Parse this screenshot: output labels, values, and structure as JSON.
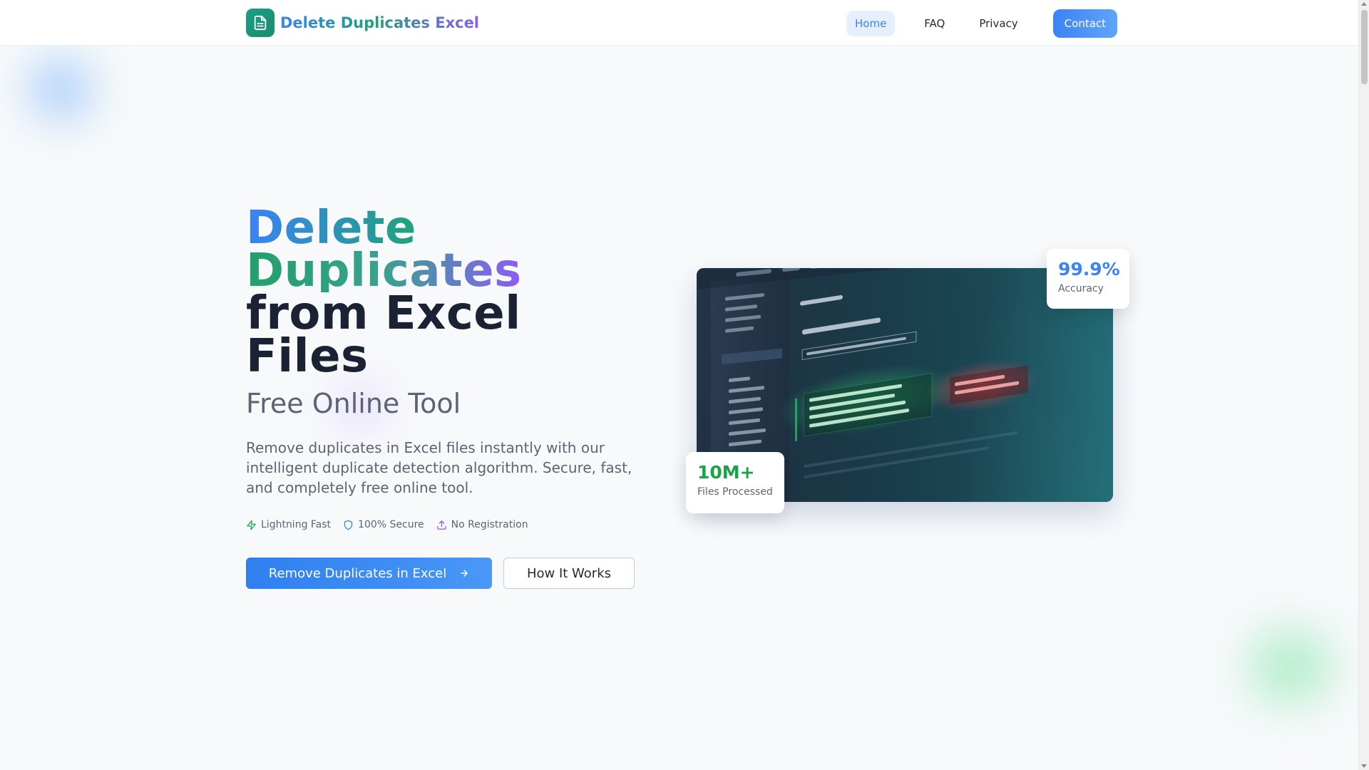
{
  "brand": {
    "title": "Delete Duplicates Excel",
    "logo_icon": "spreadsheet-document-icon",
    "logo_color": "#16a085"
  },
  "nav": {
    "home": "Home",
    "faq": "FAQ",
    "privacy": "Privacy",
    "contact": "Contact",
    "active": "Home"
  },
  "hero": {
    "title_line1": "Delete",
    "title_line2": "Duplicates",
    "title_line3": "from Excel Files",
    "subtitle": "Free Online Tool",
    "description": "Remove duplicates in Excel files instantly with our intelligent duplicate detection algorithm. Secure, fast, and completely free online tool.",
    "features": [
      {
        "icon": "lightning-icon",
        "label": "Lightning Fast",
        "color": "#16a34a"
      },
      {
        "icon": "shield-icon",
        "label": "100% Secure",
        "color": "#3b82f6"
      },
      {
        "icon": "upload-icon",
        "label": "No Registration",
        "color": "#8b5cf6"
      }
    ],
    "primary_cta": "Remove Duplicates in Excel",
    "secondary_cta": "How It Works"
  },
  "stats": {
    "accuracy_value": "99.9%",
    "accuracy_label": "Accuracy",
    "files_value": "10M+",
    "files_label": "Files Processed"
  },
  "colors": {
    "accent_blue": "#3b82f6",
    "accent_green": "#16a34a",
    "accent_purple": "#8b5cf6",
    "background": "#f7f9fb"
  }
}
